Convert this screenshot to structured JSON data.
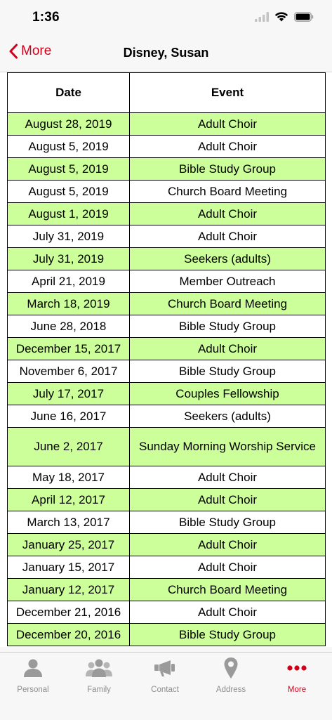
{
  "status": {
    "time": "1:36"
  },
  "nav": {
    "back_label": "More",
    "title": "Disney, Susan"
  },
  "table": {
    "headers": {
      "date": "Date",
      "event": "Event"
    },
    "rows": [
      {
        "date": "August 28, 2019",
        "event": "Adult Choir"
      },
      {
        "date": "August 5, 2019",
        "event": "Adult Choir"
      },
      {
        "date": "August 5, 2019",
        "event": "Bible Study Group"
      },
      {
        "date": "August 5, 2019",
        "event": "Church Board Meeting"
      },
      {
        "date": "August 1, 2019",
        "event": "Adult Choir"
      },
      {
        "date": "July 31, 2019",
        "event": "Adult Choir"
      },
      {
        "date": "July 31, 2019",
        "event": "Seekers (adults)"
      },
      {
        "date": "April 21, 2019",
        "event": "Member Outreach"
      },
      {
        "date": "March 18, 2019",
        "event": "Church Board Meeting"
      },
      {
        "date": "June 28, 2018",
        "event": "Bible Study Group"
      },
      {
        "date": "December 15, 2017",
        "event": "Adult Choir"
      },
      {
        "date": "November 6, 2017",
        "event": "Bible Study Group"
      },
      {
        "date": "July 17, 2017",
        "event": "Couples Fellowship"
      },
      {
        "date": "June 16, 2017",
        "event": "Seekers (adults)"
      },
      {
        "date": "June 2, 2017",
        "event": "Sunday Morning Worship Service"
      },
      {
        "date": "May 18, 2017",
        "event": "Adult Choir"
      },
      {
        "date": "April 12, 2017",
        "event": "Adult Choir"
      },
      {
        "date": "March 13, 2017",
        "event": "Bible Study Group"
      },
      {
        "date": "January 25, 2017",
        "event": "Adult Choir"
      },
      {
        "date": "January 15, 2017",
        "event": "Adult Choir"
      },
      {
        "date": "January 12, 2017",
        "event": "Church Board Meeting"
      },
      {
        "date": "December 21, 2016",
        "event": "Adult Choir"
      },
      {
        "date": "December 20, 2016",
        "event": "Bible Study Group"
      }
    ]
  },
  "colors": {
    "accent": "#d0021b",
    "row_highlight": "#ccff99",
    "tab_inactive": "#8e8e8e"
  },
  "tabs": [
    {
      "label": "Personal",
      "icon": "person-icon"
    },
    {
      "label": "Family",
      "icon": "family-icon"
    },
    {
      "label": "Contact",
      "icon": "megaphone-icon"
    },
    {
      "label": "Address",
      "icon": "map-pin-icon"
    },
    {
      "label": "More",
      "icon": "more-dots-icon"
    }
  ]
}
